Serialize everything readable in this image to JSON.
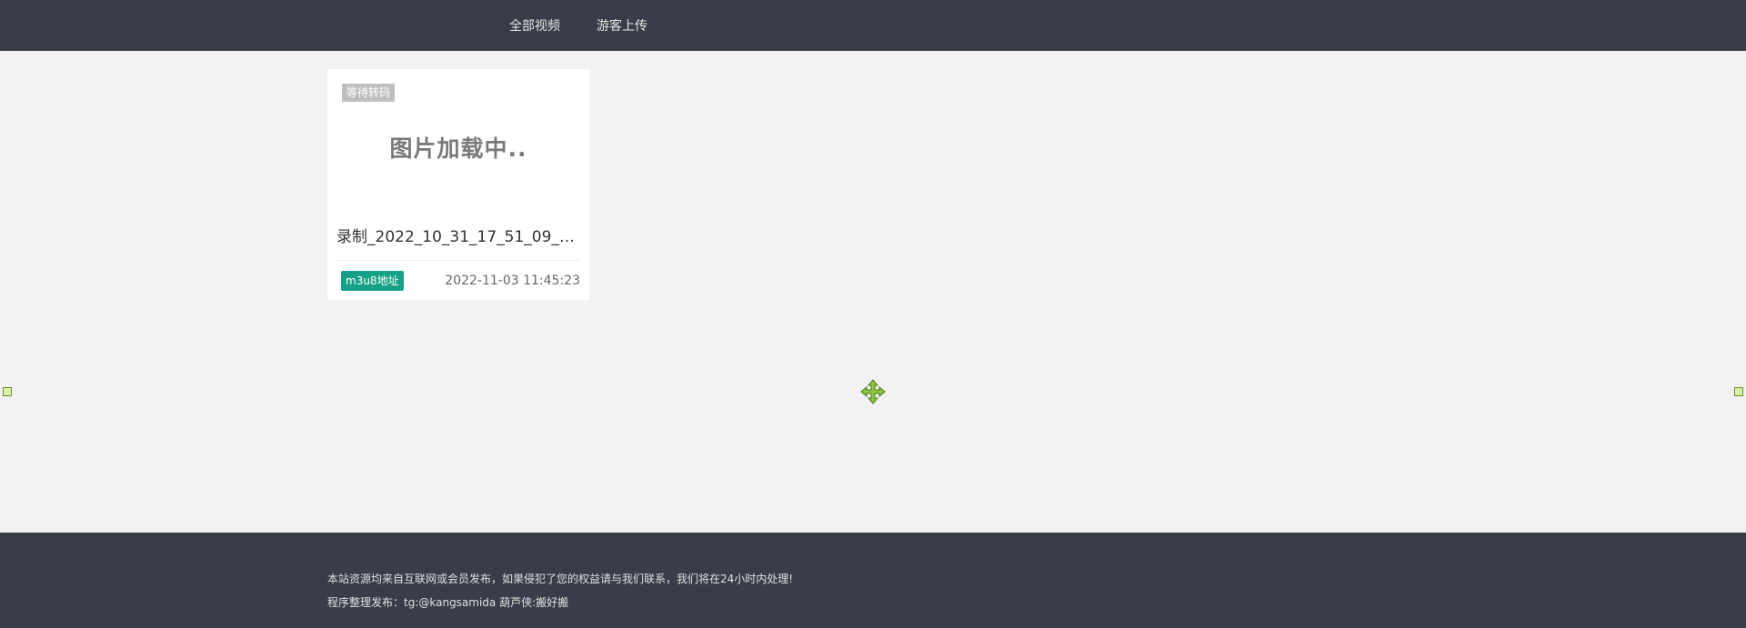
{
  "nav": {
    "items": [
      {
        "label": "全部视频"
      },
      {
        "label": "游客上传"
      }
    ]
  },
  "card": {
    "status_badge": "等待转码",
    "thumbnail_text": "图片加载中..",
    "title": "录制_2022_10_31_17_51_09_1...",
    "link_badge": "m3u8地址",
    "date": "2022-11-03 11:45:23"
  },
  "footer": {
    "line1": "本站资源均来自互联网或会员发布，如果侵犯了您的权益请与我们联系，我们将在24小时内处理!",
    "line2": "程序整理发布：tg:@kangsamida 葫芦侠:搬好搬"
  },
  "colors": {
    "header_bg": "#393d49",
    "accent_green": "#16a085",
    "badge_gray": "#bfbfbf"
  },
  "icons": {
    "move": "move-arrows-icon",
    "resize_handle": "resize-handle-icon"
  }
}
